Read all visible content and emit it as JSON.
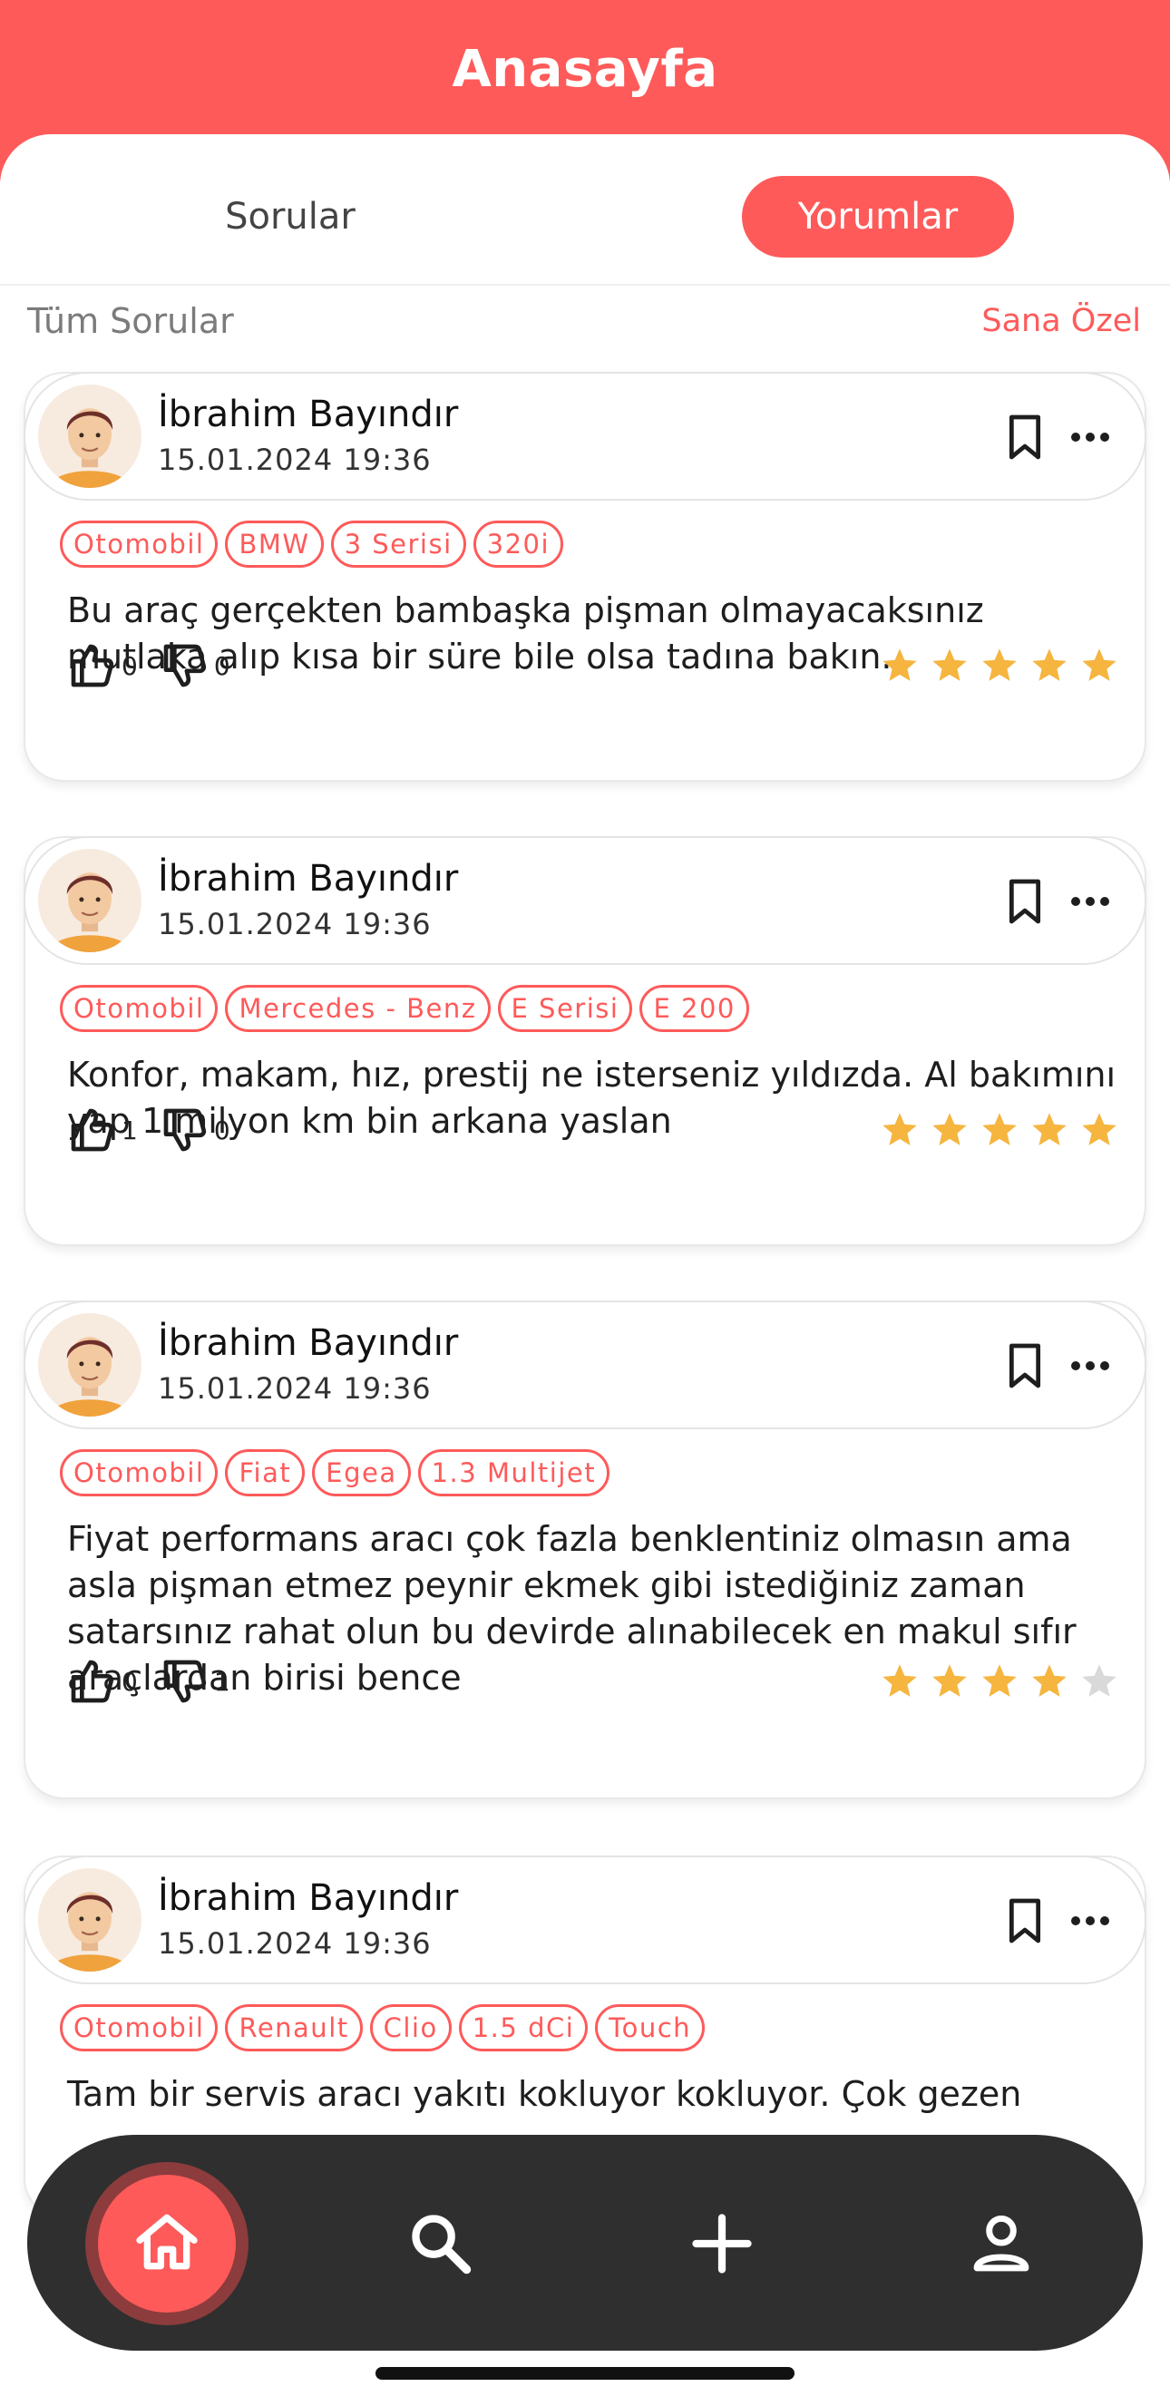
{
  "header": {
    "title": "Anasayfa"
  },
  "tabs": [
    {
      "label": "Sorular",
      "active": false
    },
    {
      "label": "Yorumlar",
      "active": true
    }
  ],
  "filter": {
    "left_label": "Tüm Sorular",
    "right_label": "Sana Özel"
  },
  "colors": {
    "accent": "#fe5a5a",
    "star_filled": "#f5b53f",
    "star_empty": "#d9d9d9",
    "nav_bg": "#2f2f2f"
  },
  "reviews": [
    {
      "author": "İbrahim Bayındır",
      "date": "15.01.2024  19:36",
      "tags": [
        "Otomobil",
        "BMW",
        "3 Serisi",
        "320i"
      ],
      "text": "Bu araç gerçekten bambaşka pişman olmayacaksınız mutlaka alıp kısa bir süre bile olsa tadına bakın.",
      "likes": "0",
      "dislikes": "0",
      "rating": 5
    },
    {
      "author": "İbrahim Bayındır",
      "date": "15.01.2024  19:36",
      "tags": [
        "Otomobil",
        "Mercedes - Benz",
        "E Serisi",
        "E 200"
      ],
      "text": "Konfor, makam, hız, prestij ne isterseniz yıldızda. Al bakımını yap 1 milyon km bin arkana yaslan",
      "likes": "1",
      "dislikes": "0",
      "rating": 5
    },
    {
      "author": "İbrahim Bayındır",
      "date": "15.01.2024  19:36",
      "tags": [
        "Otomobil",
        "Fiat",
        "Egea",
        "1.3 Multijet"
      ],
      "text": "Fiyat performans aracı çok fazla benklentiniz olmasın ama asla pişman etmez peynir ekmek gibi istediğiniz zaman satarsınız rahat olun bu devirde alınabilecek en makul sıfır araçlardan birisi bence",
      "likes": "0",
      "dislikes": "1",
      "rating": 4
    },
    {
      "author": "İbrahim Bayındır",
      "date": "15.01.2024  19:36",
      "tags": [
        "Otomobil",
        "Renault",
        "Clio",
        "1.5 dCi",
        "Touch"
      ],
      "text": "Tam bir servis aracı yakıtı kokluyor kokluyor. Çok gezen",
      "likes": "",
      "dislikes": "",
      "rating": null
    }
  ],
  "nav": {
    "items": [
      {
        "icon": "home-icon",
        "active": true
      },
      {
        "icon": "search-icon",
        "active": false
      },
      {
        "icon": "plus-icon",
        "active": false
      },
      {
        "icon": "profile-icon",
        "active": false
      }
    ]
  }
}
